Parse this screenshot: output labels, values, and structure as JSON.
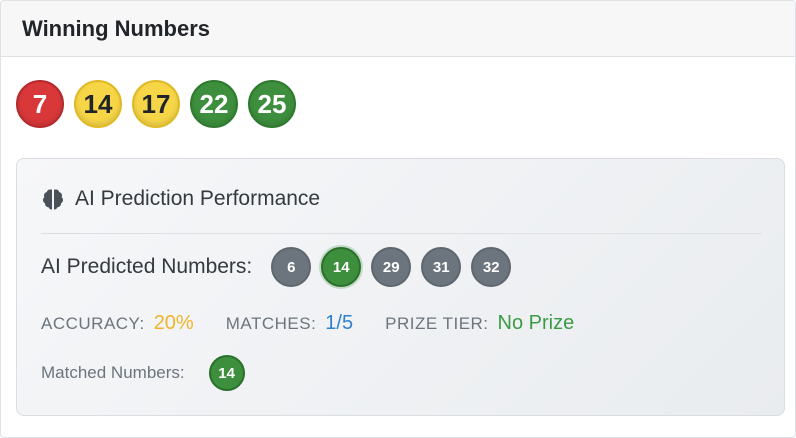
{
  "header": {
    "title": "Winning Numbers"
  },
  "winning_numbers": [
    {
      "value": "7",
      "color": "red"
    },
    {
      "value": "14",
      "color": "yellow"
    },
    {
      "value": "17",
      "color": "yellow"
    },
    {
      "value": "22",
      "color": "green"
    },
    {
      "value": "25",
      "color": "green"
    }
  ],
  "ai_panel": {
    "title": "AI Prediction Performance",
    "icon": "brain-icon",
    "predicted_label": "AI Predicted Numbers:",
    "predicted_numbers": [
      {
        "value": "6",
        "matched": false
      },
      {
        "value": "14",
        "matched": true
      },
      {
        "value": "29",
        "matched": false
      },
      {
        "value": "31",
        "matched": false
      },
      {
        "value": "32",
        "matched": false
      }
    ],
    "accuracy_label": "ACCURACY:",
    "accuracy_value": "20%",
    "matches_label": "MATCHES:",
    "matches_value": "1/5",
    "prize_tier_label": "PRIZE TIER:",
    "prize_tier_value": "No Prize",
    "matched_label": "Matched Numbers:",
    "matched_numbers": [
      "14"
    ]
  },
  "colors": {
    "red": "#d9383a",
    "yellow": "#f6d547",
    "green": "#3d8f3d",
    "gray": "#6c757d",
    "accuracy": "#f0b429",
    "matches": "#2f80d1",
    "prize": "#3d9a45"
  }
}
